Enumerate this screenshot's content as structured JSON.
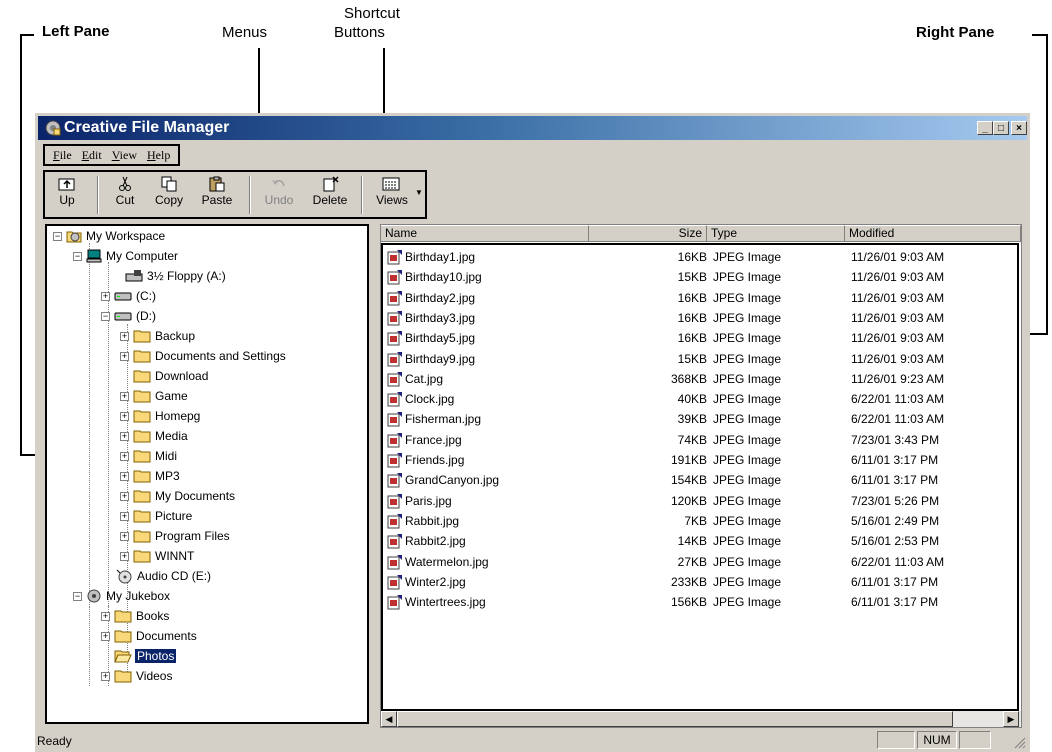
{
  "annotations": {
    "left_pane": "Left Pane",
    "menus": "Menus",
    "shortcut_buttons_line1": "Shortcut",
    "shortcut_buttons_line2": "Buttons",
    "right_pane": "Right Pane"
  },
  "window": {
    "title": "Creative File Manager",
    "minimize": "_",
    "maximize": "□",
    "close": "×"
  },
  "menu": [
    {
      "key": "F",
      "rest": "ile"
    },
    {
      "key": "E",
      "rest": "dit"
    },
    {
      "key": "V",
      "rest": "iew"
    },
    {
      "key": "H",
      "rest": "elp"
    }
  ],
  "toolbar": {
    "up": "Up",
    "cut": "Cut",
    "copy": "Copy",
    "paste": "Paste",
    "undo": "Undo",
    "delete": "Delete",
    "views": "Views"
  },
  "tree": {
    "workspace": "My Workspace",
    "computer": "My Computer",
    "floppy": "3½ Floppy (A:)",
    "c_drive": "(C:)",
    "d_drive": "(D:)",
    "d_folders": [
      "Backup",
      "Documents and Settings",
      "Download",
      "Game",
      "Homepg",
      "Media",
      "Midi",
      "MP3",
      "My Documents",
      "Picture",
      "Program Files",
      "WINNT"
    ],
    "audio_cd": "Audio CD (E:)",
    "jukebox": "My Jukebox",
    "jukebox_folders": [
      "Books",
      "Documents",
      "Photos",
      "Videos"
    ]
  },
  "list": {
    "columns": {
      "name": "Name",
      "size": "Size",
      "type": "Type",
      "modified": "Modified"
    },
    "files": [
      {
        "name": "Birthday1.jpg",
        "size": "16KB",
        "type": "JPEG Image",
        "modified": "11/26/01 9:03 AM"
      },
      {
        "name": "Birthday10.jpg",
        "size": "15KB",
        "type": "JPEG Image",
        "modified": "11/26/01 9:03 AM"
      },
      {
        "name": "Birthday2.jpg",
        "size": "16KB",
        "type": "JPEG Image",
        "modified": "11/26/01 9:03 AM"
      },
      {
        "name": "Birthday3.jpg",
        "size": "16KB",
        "type": "JPEG Image",
        "modified": "11/26/01 9:03 AM"
      },
      {
        "name": "Birthday5.jpg",
        "size": "16KB",
        "type": "JPEG Image",
        "modified": "11/26/01 9:03 AM"
      },
      {
        "name": "Birthday9.jpg",
        "size": "15KB",
        "type": "JPEG Image",
        "modified": "11/26/01 9:03 AM"
      },
      {
        "name": "Cat.jpg",
        "size": "368KB",
        "type": "JPEG Image",
        "modified": "11/26/01 9:23 AM"
      },
      {
        "name": "Clock.jpg",
        "size": "40KB",
        "type": "JPEG Image",
        "modified": "6/22/01 11:03 AM"
      },
      {
        "name": "Fisherman.jpg",
        "size": "39KB",
        "type": "JPEG Image",
        "modified": "6/22/01 11:03 AM"
      },
      {
        "name": "France.jpg",
        "size": "74KB",
        "type": "JPEG Image",
        "modified": "7/23/01 3:43 PM"
      },
      {
        "name": "Friends.jpg",
        "size": "191KB",
        "type": "JPEG Image",
        "modified": "6/11/01 3:17 PM"
      },
      {
        "name": "GrandCanyon.jpg",
        "size": "154KB",
        "type": "JPEG Image",
        "modified": "6/11/01 3:17 PM"
      },
      {
        "name": "Paris.jpg",
        "size": "120KB",
        "type": "JPEG Image",
        "modified": "7/23/01 5:26 PM"
      },
      {
        "name": "Rabbit.jpg",
        "size": "7KB",
        "type": "JPEG Image",
        "modified": "5/16/01 2:49 PM"
      },
      {
        "name": "Rabbit2.jpg",
        "size": "14KB",
        "type": "JPEG Image",
        "modified": "5/16/01 2:53 PM"
      },
      {
        "name": "Watermelon.jpg",
        "size": "27KB",
        "type": "JPEG Image",
        "modified": "6/22/01 11:03 AM"
      },
      {
        "name": "Winter2.jpg",
        "size": "233KB",
        "type": "JPEG Image",
        "modified": "6/11/01 3:17 PM"
      },
      {
        "name": "Wintertrees.jpg",
        "size": "156KB",
        "type": "JPEG Image",
        "modified": "6/11/01 3:17 PM"
      }
    ]
  },
  "status": {
    "text": "Ready",
    "num": "NUM"
  },
  "colors": {
    "title_start": "#0a246a",
    "title_end": "#a6caf0",
    "face": "#d4d0c8",
    "folder": "#f8d878",
    "selection": "#0a246a"
  }
}
